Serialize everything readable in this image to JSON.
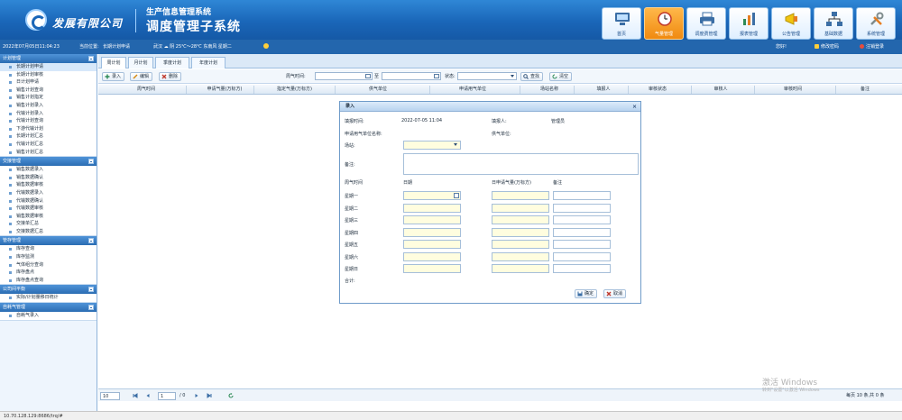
{
  "header": {
    "company": "发展有限公司",
    "system_top": "生产信息管理系统",
    "system_main": "调度管理子系统",
    "nav": [
      {
        "label": "首页",
        "icon": "monitor-icon"
      },
      {
        "label": "气量管理",
        "icon": "clock-icon"
      },
      {
        "label": "调度费管理",
        "icon": "printer-icon"
      },
      {
        "label": "报表管理",
        "icon": "chart-icon"
      },
      {
        "label": "公告管理",
        "icon": "megaphone-icon"
      },
      {
        "label": "基础数据",
        "icon": "network-icon"
      },
      {
        "label": "系统管理",
        "icon": "tools-icon"
      }
    ],
    "active_nav_index": 1
  },
  "infobar": {
    "datetime": "2022年07月05日11:04:23",
    "location_label": "当前位置:",
    "location_value": "长期计划申请",
    "weather": "武汉 ☁ 阴 25℃～28℃ 东南风 星期二",
    "greeting": "您好!",
    "change_password": "修改密码",
    "logout": "注销登录"
  },
  "sidebar": {
    "groups": [
      {
        "title": "计划管理",
        "items": [
          "长期计划申请",
          "长期计划审核",
          "日计划申请",
          "销售计划查询",
          "销售计划指定",
          "销售计划录入",
          "代输计划录入",
          "代输计划查询",
          "下游代输计划",
          "长期计划汇总",
          "代输计划汇总",
          "销售计划汇总"
        ]
      },
      {
        "title": "交接管理",
        "items": [
          "销售数据录入",
          "销售数据确认",
          "销售数据审核",
          "代输数据录入",
          "代输数据确认",
          "代输数据审核",
          "销售数据审核",
          "交接单汇总",
          "交接数据汇总"
        ]
      },
      {
        "title": "管存管理",
        "items": [
          "库存查询",
          "库存监测",
          "气体组分查询",
          "库存盘点",
          "库存盘点查询"
        ]
      },
      {
        "title": "公司间平衡",
        "items": [
          "实际/计划量移日统计"
        ]
      },
      {
        "title": "自耗气管理",
        "items": [
          "自耗气录入"
        ]
      }
    ],
    "selected_item": "长期计划申请"
  },
  "main": {
    "tabs": [
      "周计划",
      "月计划",
      "季度计划",
      "年度计划"
    ],
    "toolbar": {
      "add": "录入",
      "edit": "编辑",
      "delete": "删除",
      "period_label": "周气时间:",
      "to_label": "至",
      "status_label": "状态:",
      "search": "查找",
      "clear": "清空"
    },
    "columns": [
      "周气时间",
      "申请气量(万标方)",
      "指定气量(万标方)",
      "供气单位",
      "申请用气单位",
      "场站名称",
      "填报人",
      "审核状态",
      "审核人",
      "审核时间",
      "备注"
    ],
    "pager": {
      "page_size": "10",
      "page_input": "1",
      "total_pages": "/ 0",
      "info": "每页 10 条,共 0 条"
    }
  },
  "dialog": {
    "title": "录入",
    "fill_time_label": "填报时间:",
    "fill_time_value": "2022-07-05 11:04",
    "filler_label": "填报人:",
    "filler_value": "管理员",
    "applicant_label": "申请用气单位名称:",
    "supplier_label": "供气单位:",
    "station_label": "场站:",
    "remark_label": "备注:",
    "col_period": "周气时间",
    "col_date": "日期",
    "col_qty": "日申请气量(万标方)",
    "col_remark": "备注",
    "weekdays": [
      "星期一",
      "星期二",
      "星期三",
      "星期四",
      "星期五",
      "星期六",
      "星期日"
    ],
    "total_label": "合计:",
    "confirm": "确定",
    "cancel": "取消"
  },
  "watermark": {
    "line1": "激活 Windows",
    "line2": "转到\"设置\"以激活 Windows"
  },
  "status_url": "10.70.128.129:8686/trq/#",
  "colors": {
    "header_blue": "#1a66b8",
    "active_orange": "#f08a10",
    "input_yellow": "#fffddf"
  }
}
